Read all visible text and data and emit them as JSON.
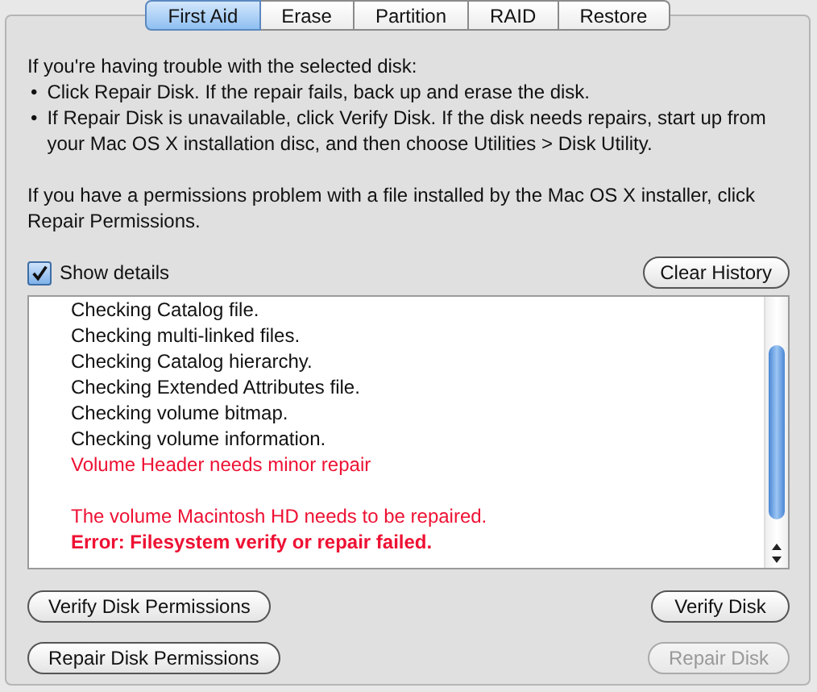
{
  "tabs": [
    {
      "label": "First Aid",
      "selected": true
    },
    {
      "label": "Erase",
      "selected": false
    },
    {
      "label": "Partition",
      "selected": false
    },
    {
      "label": "RAID",
      "selected": false
    },
    {
      "label": "Restore",
      "selected": false
    }
  ],
  "intro": "If you're having trouble with the selected disk:",
  "bullets": [
    "Click Repair Disk. If the repair fails, back up and erase the disk.",
    "If Repair Disk is unavailable, click Verify Disk. If the disk needs repairs, start up from your Mac OS X installation disc, and then choose Utilities > Disk Utility."
  ],
  "bullet_mark": "•",
  "permissions_note": "If you have a permissions problem with a file installed by the Mac OS X installer, click Repair Permissions.",
  "show_details": {
    "label": "Show details",
    "checked": true
  },
  "clear_history": "Clear History",
  "log": [
    {
      "text": "Checking Catalog file.",
      "kind": "info"
    },
    {
      "text": "Checking multi-linked files.",
      "kind": "info"
    },
    {
      "text": "Checking Catalog hierarchy.",
      "kind": "info"
    },
    {
      "text": "Checking Extended Attributes file.",
      "kind": "info"
    },
    {
      "text": "Checking volume bitmap.",
      "kind": "info"
    },
    {
      "text": "Checking volume information.",
      "kind": "info"
    },
    {
      "text": "Volume Header needs minor repair",
      "kind": "warning"
    },
    {
      "text": "The volume Macintosh HD needs to be repaired.",
      "kind": "notice"
    },
    {
      "text": "Error: Filesystem verify or repair failed.",
      "kind": "error"
    }
  ],
  "buttons": {
    "left": [
      {
        "label": "Verify Disk Permissions",
        "disabled": false
      },
      {
        "label": "Repair Disk Permissions",
        "disabled": false
      }
    ],
    "right": [
      {
        "label": "Verify Disk",
        "disabled": false
      },
      {
        "label": "Repair Disk",
        "disabled": true
      }
    ]
  }
}
